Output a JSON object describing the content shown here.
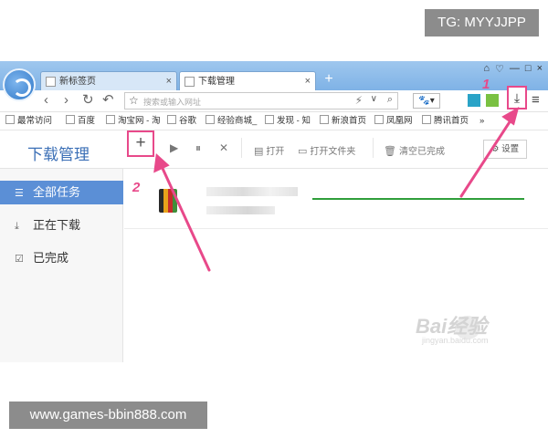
{
  "overlay": {
    "tg_text": "TG: MYYJJPP",
    "site_text": "www.games-bbin888.com"
  },
  "browser": {
    "tabs": [
      {
        "label": "新标签页",
        "close": "×"
      },
      {
        "label": "下载管理",
        "close": "×"
      }
    ],
    "new_tab": "+",
    "window_controls": [
      "⌂",
      "♡",
      "—",
      "□",
      "×"
    ],
    "nav": {
      "back": "‹",
      "forward": "›",
      "refresh": "↻",
      "undo": "↶",
      "address_placeholder": "搜索或输入网址",
      "search_engine": "🐾▾",
      "menu": "≡",
      "download": "⤓"
    },
    "bookmarks": [
      "最常访问",
      "百度",
      "淘宝网 - 淘",
      "谷歌",
      "经验商城_",
      "发现 - 知",
      "新浪首页",
      "凤凰网",
      "腾讯首页"
    ],
    "bookmarks_more": "»"
  },
  "download_manager": {
    "title": "下载管理",
    "add_label": "+",
    "toolbar": {
      "start": "▶",
      "pause": "⏸",
      "delete": "✕",
      "open": "打开",
      "open_folder": "打开文件夹",
      "clear_done": "清空已完成",
      "settings": "设置"
    },
    "sidebar": [
      {
        "label": "全部任务",
        "active": true
      },
      {
        "label": "正在下载",
        "active": false
      },
      {
        "label": "已完成",
        "active": false
      }
    ],
    "task": {
      "progress": 1.0
    }
  },
  "callouts": {
    "one": "1",
    "two": "2"
  },
  "watermark": {
    "brand": "Bai经验",
    "sub": "jingyan.baidu.com"
  },
  "colors": {
    "accent": "#5b8fd6",
    "highlight": "#e8498a",
    "progress": "#2f9e3a"
  }
}
